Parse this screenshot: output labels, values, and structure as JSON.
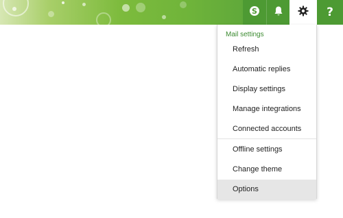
{
  "header": {
    "buttons": [
      {
        "name": "skype",
        "icon": "skype-icon"
      },
      {
        "name": "notifications",
        "icon": "bell-icon"
      },
      {
        "name": "settings",
        "icon": "gear-icon"
      },
      {
        "name": "help",
        "icon": "question-icon",
        "glyph": "?"
      }
    ],
    "colors": {
      "accent_green": "#4d9a33",
      "heading_green": "#3a8a2f",
      "selected_bg": "#e6e6e6"
    }
  },
  "menu": {
    "heading": "Mail settings",
    "items": [
      {
        "label": "Refresh"
      },
      {
        "label": "Automatic replies"
      },
      {
        "label": "Display settings"
      },
      {
        "label": "Manage integrations"
      },
      {
        "label": "Connected accounts"
      },
      {
        "label": "Offline settings"
      },
      {
        "label": "Change theme"
      },
      {
        "label": "Options",
        "selected": true
      }
    ]
  }
}
